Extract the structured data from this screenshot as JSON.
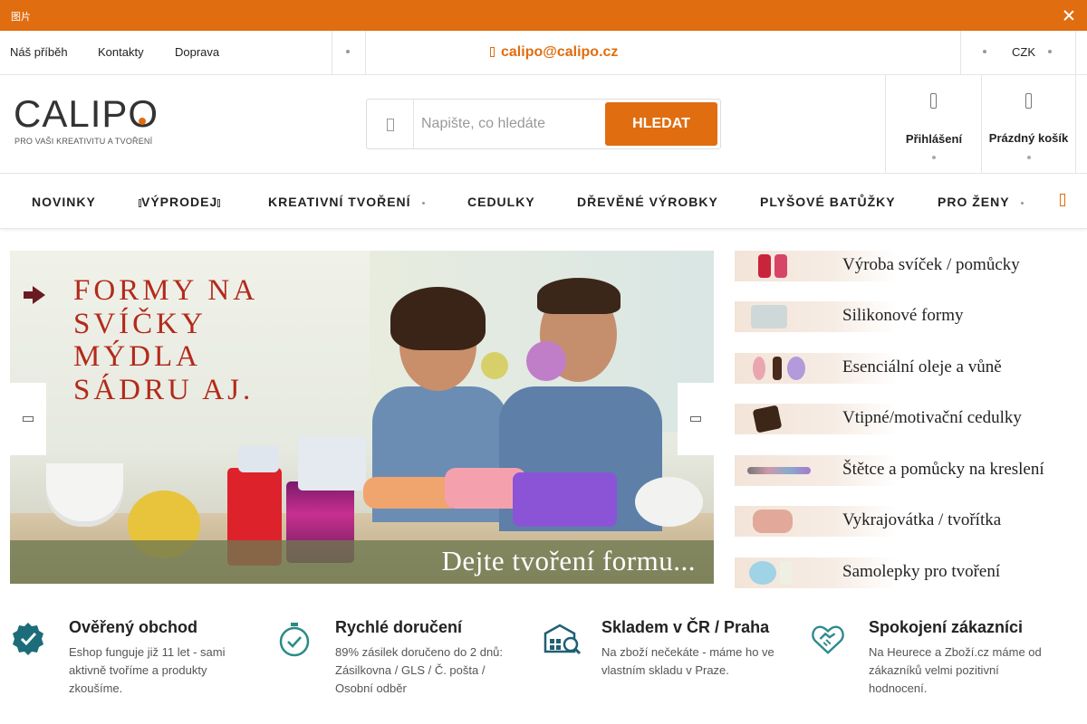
{
  "notice": {
    "text": "图片"
  },
  "util": {
    "links": [
      "Náš příběh",
      "Kontakty",
      "Doprava"
    ],
    "email": "calipo@calipo.cz",
    "currency": "CZK"
  },
  "logo": {
    "wordmark": "CALIPO",
    "tagline": "PRO VAŠI KREATIVITU A TVOŘENÍ"
  },
  "search": {
    "placeholder": "Napište, co hledáte",
    "button": "HLEDAT"
  },
  "account": {
    "login": "Přihlášení",
    "cart": "Prázdný košík"
  },
  "nav": {
    "items": [
      "NOVINKY",
      "VÝPRODEJ",
      "KREATIVNÍ TVOŘENÍ",
      "CEDULKY",
      "DŘEVĚNÉ VÝROBKY",
      "PLYŠOVÉ BATŮŽKY",
      "PRO ŽENY"
    ]
  },
  "banner": {
    "headline": "FORMY NA\nSVÍČKY\nMÝDLA\nSÁDRU AJ.",
    "tagline": "Dejte tvoření formu..."
  },
  "categories": [
    "Výroba svíček / pomůcky",
    "Silikonové formy",
    "Esenciální oleje a vůně",
    "Vtipné/motivační cedulky",
    "Štětce a pomůcky na kreslení",
    "Vykrajovátka / tvořítka",
    "Samolepky pro tvoření"
  ],
  "benefits": [
    {
      "title": "Ověřený obchod",
      "text": "Eshop funguje již 11 let - sami aktivně tvoříme a produkty zkoušíme.",
      "icon": "verified-badge-icon"
    },
    {
      "title": "Rychlé doručení",
      "text": "89% zásilek doručeno do 2 dnů: Zásilkovna / GLS / Č. pošta / Osobní odběr",
      "icon": "stopwatch-icon"
    },
    {
      "title": "Skladem v ČR / Praha",
      "text": "Na zboží nečekáte - máme ho ve vlastním skladu v Praze.",
      "icon": "warehouse-icon"
    },
    {
      "title": "Spokojení zákazníci",
      "text": "Na Heurece a Zboží.cz máme od zákazníků velmi pozitivní hodnocení.",
      "icon": "handshake-heart-icon"
    }
  ],
  "colors": {
    "accent": "#e06d10",
    "text": "#222222",
    "banner_headline": "#b32a1b"
  }
}
